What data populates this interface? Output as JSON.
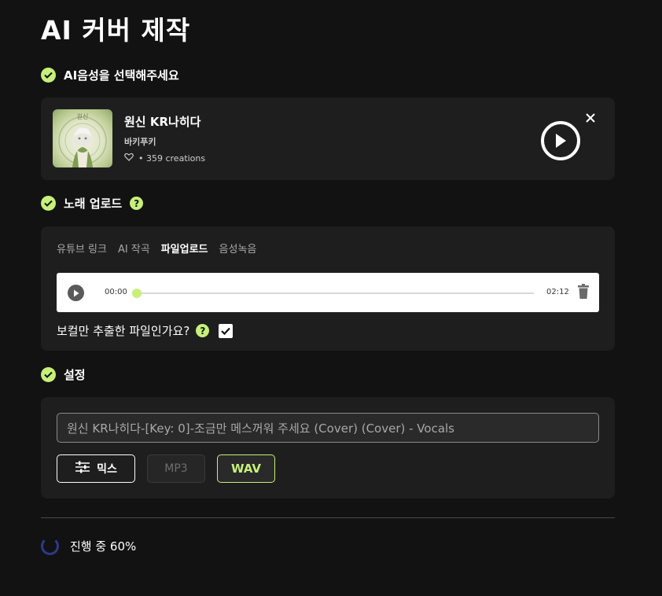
{
  "page": {
    "title": "AI 커버 제작"
  },
  "voice_section": {
    "heading": "AI음성을 선택해주세요",
    "voice": {
      "name": "원신 KR나히다",
      "author": "바키푸키",
      "creations": "• 359 creations",
      "thumb_caption": "원신"
    }
  },
  "upload_section": {
    "heading": "노래 업로드",
    "tabs": [
      {
        "label": "유튜브 링크",
        "active": false
      },
      {
        "label": "AI 작곡",
        "active": false
      },
      {
        "label": "파일업로드",
        "active": true
      },
      {
        "label": "음성녹음",
        "active": false
      }
    ],
    "player": {
      "current_time": "00:00",
      "duration": "02:12",
      "progress": 0
    },
    "vocal_question": "보컬만 추출한 파일인가요?",
    "vocal_checked": true
  },
  "settings_section": {
    "heading": "설정",
    "output_name": "원신 KR나히다-[Key: 0]-조금만 메스꺼워 주세요 (Cover) (Cover) - Vocals",
    "mix_label": "믹스",
    "formats": [
      {
        "label": "MP3",
        "selected": false
      },
      {
        "label": "WAV",
        "selected": true
      }
    ]
  },
  "progress": {
    "label": "진행 중 60%",
    "percent": 60
  },
  "colors": {
    "accent": "#c6f07a",
    "background": "#121212",
    "card": "#1e1e1e",
    "spinner": "#2d3a8a"
  }
}
